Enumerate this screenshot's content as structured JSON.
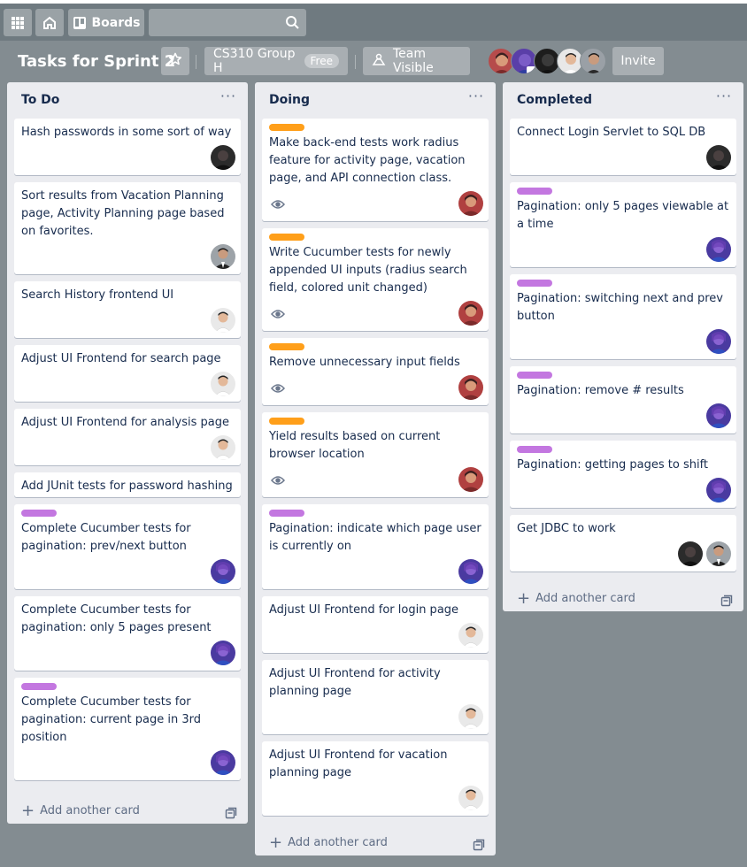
{
  "nav": {
    "boards_label": "Boards"
  },
  "board": {
    "title": "Tasks for Sprint 2",
    "team_name": "CS310 Group H",
    "team_badge": "Free",
    "visibility_label": "Team Visible",
    "invite_label": "Invite"
  },
  "colors": {
    "label_orange": "#ff9f1a",
    "label_purple": "#c377e0",
    "list_bg": "#ebecf0",
    "board_bg": "#838c91"
  },
  "lists": [
    {
      "title": "To Do",
      "add_label": "Add another card",
      "cards": [
        {
          "text": "Hash passwords in some sort of way"
        },
        {
          "text": "Sort results from Vacation Planning page, Activity Planning page based on favorites."
        },
        {
          "text": "Search History frontend UI"
        },
        {
          "text": "Adjust UI Frontend for search page"
        },
        {
          "text": "Adjust UI Frontend for analysis page"
        },
        {
          "text": "Add JUnit tests for password hashing"
        },
        {
          "text": "Complete Cucumber tests for pagination: prev/next button",
          "label": "purple"
        },
        {
          "text": "Complete Cucumber tests for pagination: only 5 pages present"
        },
        {
          "text": "Complete Cucumber tests for pagination: current page in 3rd position",
          "label": "purple"
        }
      ]
    },
    {
      "title": "Doing",
      "add_label": "Add another card",
      "cards": [
        {
          "text": "Make back-end tests work radius feature for activity page, vacation page, and API connection class.",
          "label": "orange"
        },
        {
          "text": "Write Cucumber tests for newly appended UI inputs (radius search field, colored unit changed)",
          "label": "orange"
        },
        {
          "text": "Remove unnecessary input fields",
          "label": "orange"
        },
        {
          "text": "Yield results based on current browser location",
          "label": "orange"
        },
        {
          "text": "Pagination: indicate which page user is currently on",
          "label": "purple"
        },
        {
          "text": "Adjust UI Frontend for login page"
        },
        {
          "text": "Adjust UI Frontend for activity planning page"
        },
        {
          "text": "Adjust UI Frontend for vacation planning page"
        }
      ]
    },
    {
      "title": "Completed",
      "add_label": "Add another card",
      "cards": [
        {
          "text": "Connect Login Servlet to SQL DB"
        },
        {
          "text": "Pagination: only 5 pages viewable at a time",
          "label": "purple"
        },
        {
          "text": "Pagination: switching next and prev button",
          "label": "purple"
        },
        {
          "text": "Pagination: remove # results",
          "label": "purple"
        },
        {
          "text": "Pagination: getting pages to shift",
          "label": "purple"
        },
        {
          "text": "Get JDBC to work"
        }
      ]
    }
  ]
}
